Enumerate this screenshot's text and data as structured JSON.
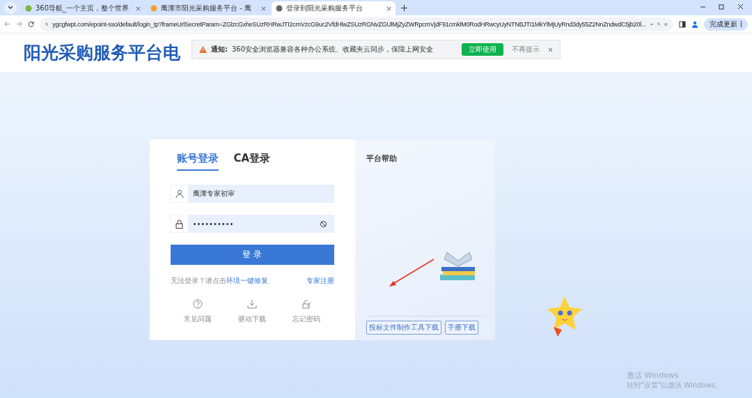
{
  "browser": {
    "tabs": [
      {
        "title": "360导航_一个主页，整个世界",
        "selected": false
      },
      {
        "title": "鹰潭市阳光采购服务平台 - 鹰",
        "selected": false
      },
      {
        "title": "登录到阳光采购服务平台",
        "selected": true
      }
    ],
    "address": "ygcgfwpt.com/epoint-sso/default/login_tp?frameUrlSecretParam=ZGlzcGxheSUzRHRwJTI2cmVzcG9uc2VfdHlwZSUzRGNvZGUlMjZyZWRpcmVjdF91cmklM0RodHRwcyUyNTNBJTI1MkYlMjUyRnd3dy55Z2NnZndwdC5jb20l...",
    "update_button": "完成更新"
  },
  "site_title": "阳光采购服务平台电",
  "notification": {
    "label": "通知:",
    "message": "360安全浏览器兼容各种办公系统、收藏夹云同步，保障上网安全",
    "action": "立即使用",
    "dismiss": "不再提示"
  },
  "login": {
    "tabs": [
      {
        "label": "账号登录",
        "selected": true
      },
      {
        "label": "CA登录",
        "selected": false
      }
    ],
    "username": "鹰潭专家初审",
    "password": "••••••••••",
    "submit": "登 录",
    "repair_prompt": "无法登录？请点击",
    "repair_link": "环境一键修复",
    "register_link": "专家注册",
    "shortcuts": [
      {
        "kind": "help",
        "label": "常见问题"
      },
      {
        "kind": "download",
        "label": "驱动下载"
      },
      {
        "kind": "password",
        "label": "忘记密码"
      }
    ]
  },
  "help": {
    "title": "平台帮助",
    "buttons": [
      "投标文件制作工具下载",
      "手册下载"
    ]
  },
  "os_watermark": {
    "title": "激活 Windows",
    "hint": "转到\"设置\"以激活 Windows。"
  }
}
